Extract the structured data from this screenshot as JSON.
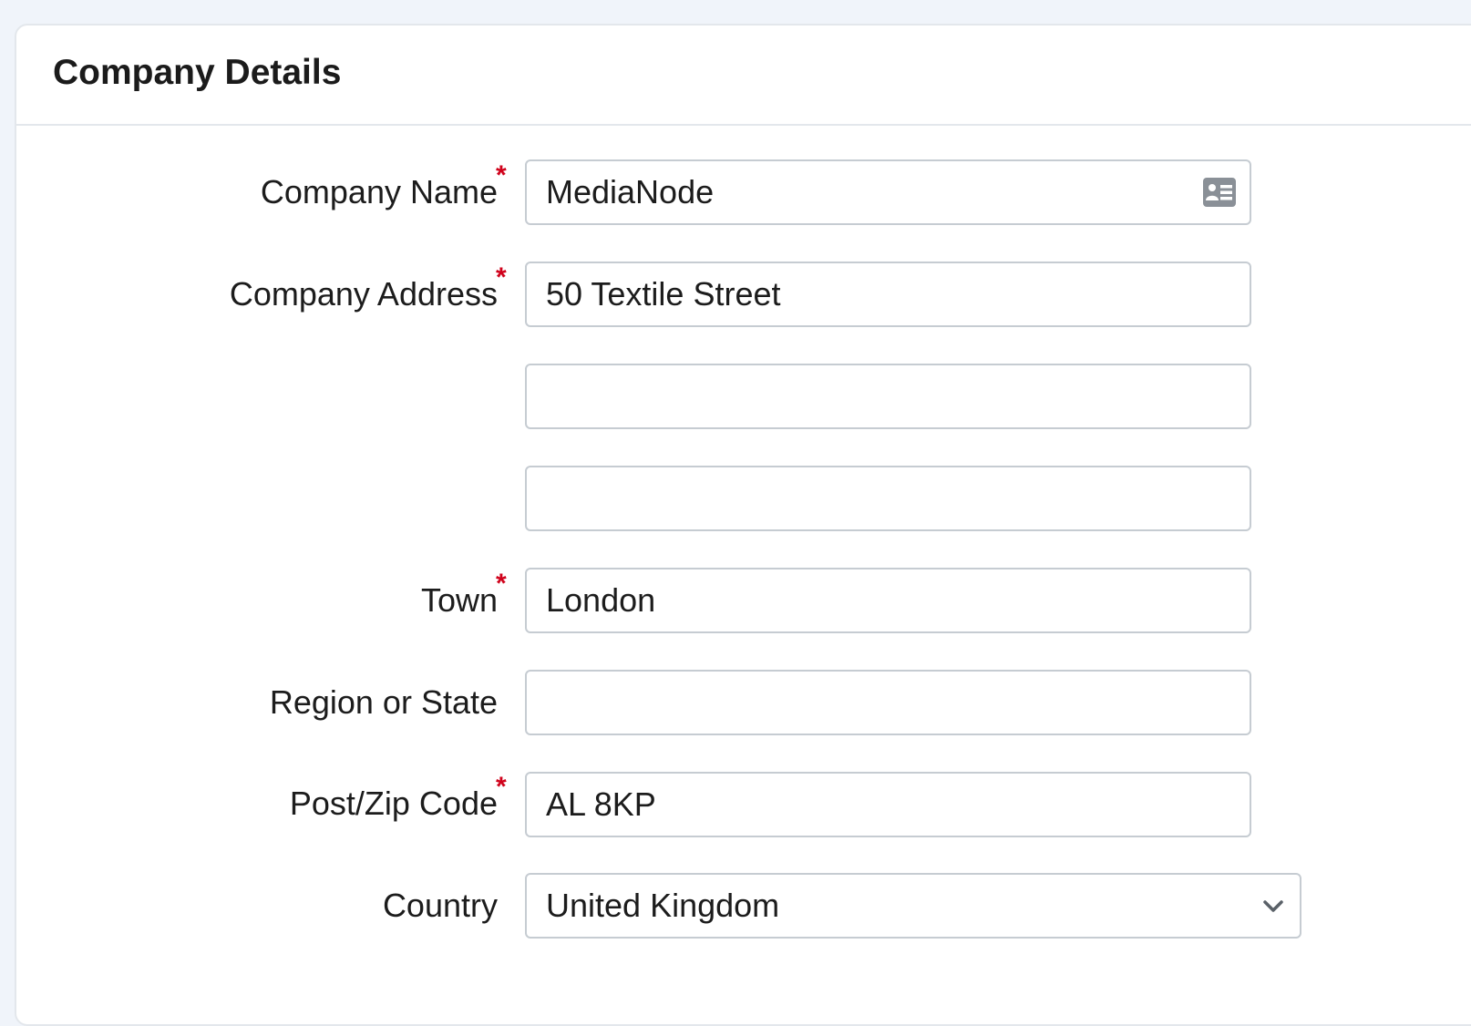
{
  "header": {
    "title": "Company Details"
  },
  "form": {
    "company_name": {
      "label": "Company Name",
      "required_mark": "*",
      "value": "MediaNode",
      "icon": "contact-card-icon"
    },
    "company_address": {
      "label": "Company Address",
      "required_mark": "*",
      "line1": "50 Textile Street",
      "line2": "",
      "line3": ""
    },
    "town": {
      "label": "Town",
      "required_mark": "*",
      "value": "London"
    },
    "region": {
      "label": "Region or State",
      "value": ""
    },
    "postcode": {
      "label": "Post/Zip Code",
      "required_mark": "*",
      "value": "AL 8KP"
    },
    "country": {
      "label": "Country",
      "value": "United Kingdom",
      "icon": "chevron-down-icon"
    }
  },
  "colors": {
    "page_background": "#f0f4fa",
    "card_background": "#ffffff",
    "border": "#c6ccd2",
    "required": "#d0021b",
    "icon": "#8a9097"
  }
}
